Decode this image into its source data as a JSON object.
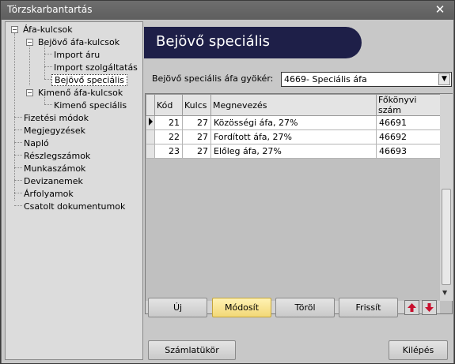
{
  "window": {
    "title": "Törzskarbantartás"
  },
  "tree": {
    "items": [
      {
        "label": "Áfa-kulcsok"
      },
      {
        "label": "Bejövő áfa-kulcsok"
      },
      {
        "label": "Import áru"
      },
      {
        "label": "Import szolgáltatás"
      },
      {
        "label": "Bejövő speciális"
      },
      {
        "label": "Kimenő áfa-kulcsok"
      },
      {
        "label": "Kimenő speciális"
      },
      {
        "label": "Fizetési módok"
      },
      {
        "label": "Megjegyzések"
      },
      {
        "label": "Napló"
      },
      {
        "label": "Részlegszámok"
      },
      {
        "label": "Munkaszámok"
      },
      {
        "label": "Devizanemek"
      },
      {
        "label": "Árfolyamok"
      },
      {
        "label": "Csatolt dokumentumok"
      }
    ]
  },
  "panel": {
    "title": "Bejövő speciális",
    "root_label": "Bejövő speciális áfa gyökér:",
    "root_value": "4669- Speciális áfa"
  },
  "grid": {
    "columns": [
      "Kód",
      "Kulcs",
      "Megnevezés",
      "Főkönyvi szám"
    ],
    "rows": [
      {
        "kod": "21",
        "kulcs": "27",
        "megnevezes": "Közösségi áfa, 27%",
        "fokonyv": "46691"
      },
      {
        "kod": "22",
        "kulcs": "27",
        "megnevezes": "Fordított áfa, 27%",
        "fokonyv": "46692"
      },
      {
        "kod": "23",
        "kulcs": "27",
        "megnevezes": "Előleg áfa, 27%",
        "fokonyv": "46693"
      }
    ]
  },
  "buttons": {
    "new": "Új",
    "modify": "Módosít",
    "delete": "Töröl",
    "refresh": "Frissít",
    "chart_of_accounts": "Számlatükör",
    "exit": "Kilépés"
  },
  "colors": {
    "banner": "#1e1f48",
    "active_button": "#f2d877",
    "up_down_arrow": "#c8102e"
  }
}
